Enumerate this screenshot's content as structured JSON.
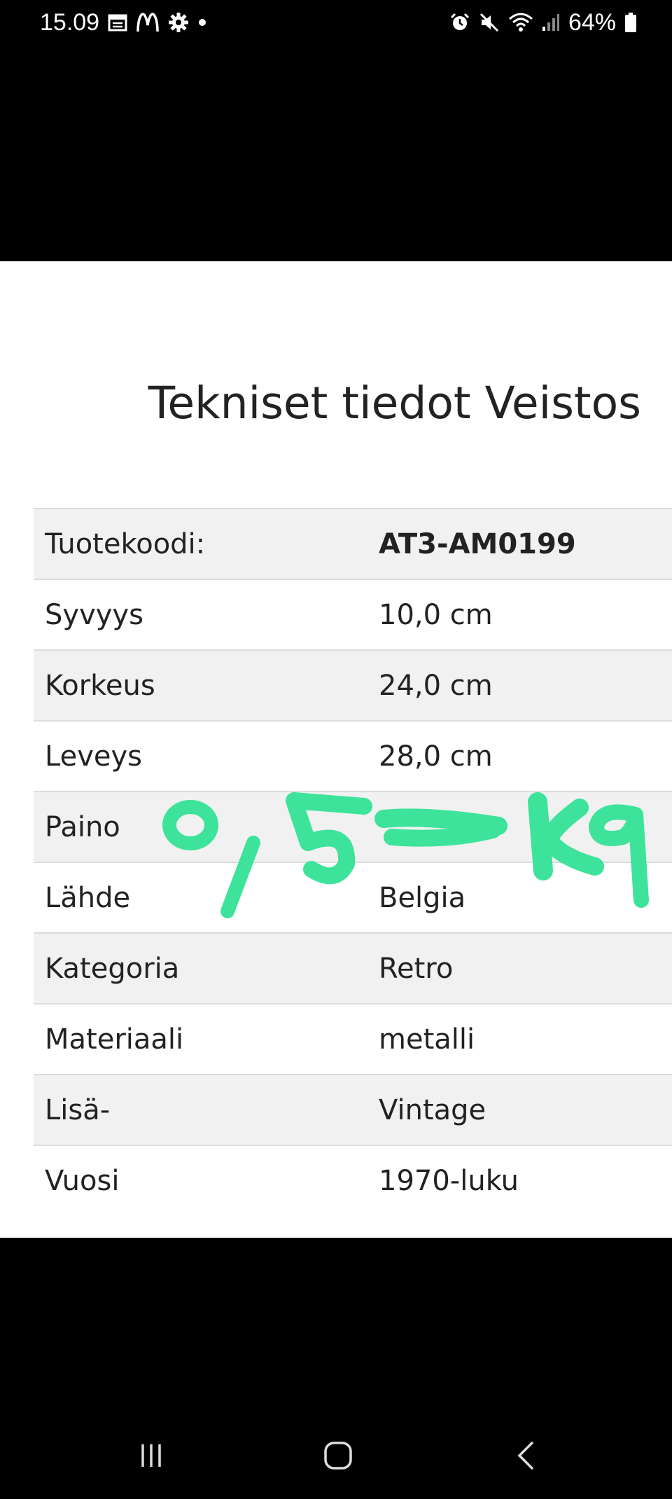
{
  "status_bar": {
    "time": "15.09",
    "battery": "64%",
    "left_icons": [
      "calendar-icon",
      "mcdonalds-icon",
      "settings-icon",
      "notification-dot-icon"
    ],
    "right_icons": [
      "alarm-icon",
      "mute-icon",
      "wifi-icon",
      "signal-icon",
      "battery-icon"
    ]
  },
  "page": {
    "title": "Tekniset tiedot Veistos"
  },
  "specs": [
    {
      "label": "Tuotekoodi:",
      "value": "AT3-AM0199"
    },
    {
      "label": "Syvyys",
      "value": "10,0 cm"
    },
    {
      "label": "Korkeus",
      "value": "24,0 cm"
    },
    {
      "label": "Leveys",
      "value": "28,0 cm"
    },
    {
      "label": "Paino",
      "value": ""
    },
    {
      "label": "Lähde",
      "value": "Belgia"
    },
    {
      "label": "Kategoria",
      "value": "Retro"
    },
    {
      "label": "Materiaali",
      "value": "metalli"
    },
    {
      "label": "Lisä-",
      "value": "Vintage"
    },
    {
      "label": "Vuosi",
      "value": "1970-luku"
    }
  ],
  "annotation": {
    "handwritten_text": "0,5 kg",
    "color": "#3de39a"
  },
  "colors": {
    "background": "#000000",
    "panel": "#ffffff",
    "row_shade": "#f1f1f1",
    "text": "#222222"
  },
  "nav_bar": {
    "icons": [
      "recent-apps-icon",
      "home-icon",
      "back-icon"
    ]
  }
}
